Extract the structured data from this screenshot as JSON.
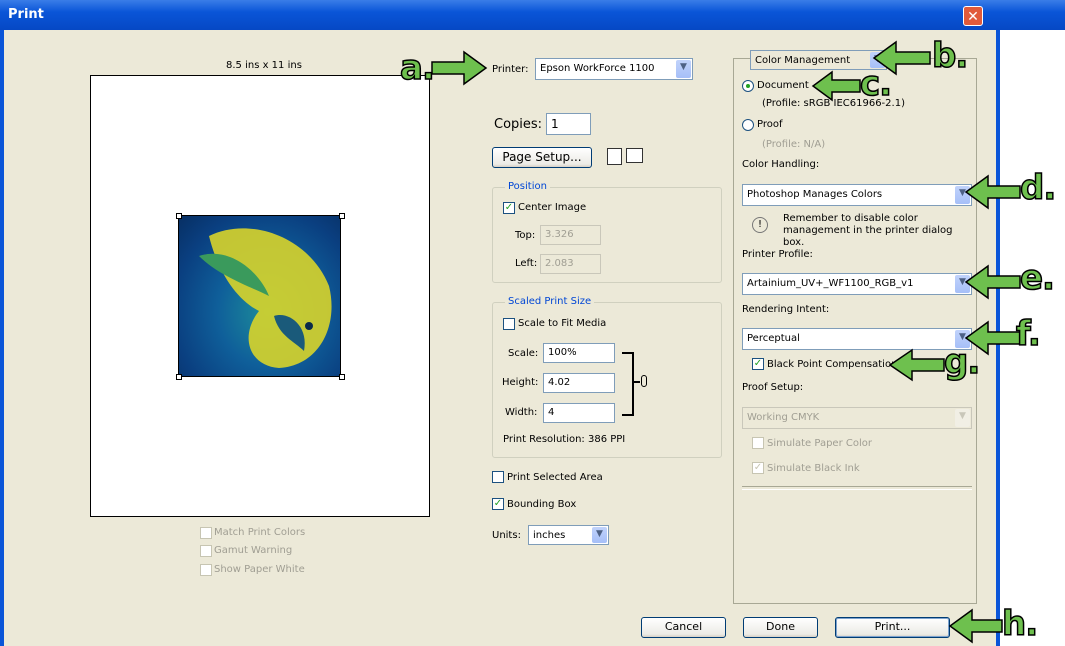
{
  "window": {
    "title": "Print",
    "close_glyph": "✕"
  },
  "preview": {
    "paper_size": "8.5 ins x 11 ins",
    "options": [
      {
        "label": "Match Print Colors",
        "checked": false
      },
      {
        "label": "Gamut Warning",
        "checked": false
      },
      {
        "label": "Show Paper White",
        "checked": false
      }
    ]
  },
  "printer": {
    "label": "Printer:",
    "value": "Epson WorkForce 1100"
  },
  "copies": {
    "label": "Copies:",
    "value": "1"
  },
  "page_setup": {
    "label": "Page Setup..."
  },
  "position": {
    "title": "Position",
    "center_image": "Center Image",
    "top_label": "Top:",
    "top_value": "3.326",
    "left_label": "Left:",
    "left_value": "2.083"
  },
  "scaled": {
    "title": "Scaled Print Size",
    "scale_to_fit": "Scale to Fit Media",
    "scale_label": "Scale:",
    "scale_value": "100%",
    "height_label": "Height:",
    "height_value": "4.02",
    "width_label": "Width:",
    "width_value": "4",
    "resolution": "Print Resolution: 386 PPI"
  },
  "print_selected_area": "Print Selected Area",
  "bounding_box": "Bounding Box",
  "units": {
    "label": "Units:",
    "value": "inches"
  },
  "color": {
    "mode": "Color Management",
    "document": "Document",
    "document_profile": "(Profile: sRGB IEC61966-2.1)",
    "proof": "Proof",
    "proof_profile": "(Profile: N/A)",
    "handling_label": "Color Handling:",
    "handling_value": "Photoshop Manages Colors",
    "note": "Remember to disable color management in the printer dialog box.",
    "printer_profile_label": "Printer Profile:",
    "printer_profile_value": "Artainium_UV+_WF1100_RGB_v1",
    "intent_label": "Rendering Intent:",
    "intent_value": "Perceptual",
    "bpc": "Black Point Compensation",
    "proof_setup_label": "Proof Setup:",
    "proof_setup_value": "Working CMYK",
    "sim_paper": "Simulate Paper Color",
    "sim_ink": "Simulate Black Ink"
  },
  "buttons": {
    "cancel": "Cancel",
    "done": "Done",
    "print": "Print..."
  },
  "callouts": {
    "a": "a.",
    "b": "b.",
    "c": "c.",
    "d": "d.",
    "e": "e.",
    "f": "f.",
    "g": "g.",
    "h": "h."
  },
  "colors": {
    "titlebar": "#0a55d8",
    "dialog": "#ece9d8",
    "callout": "#6ec04e",
    "check": "#21a121"
  }
}
